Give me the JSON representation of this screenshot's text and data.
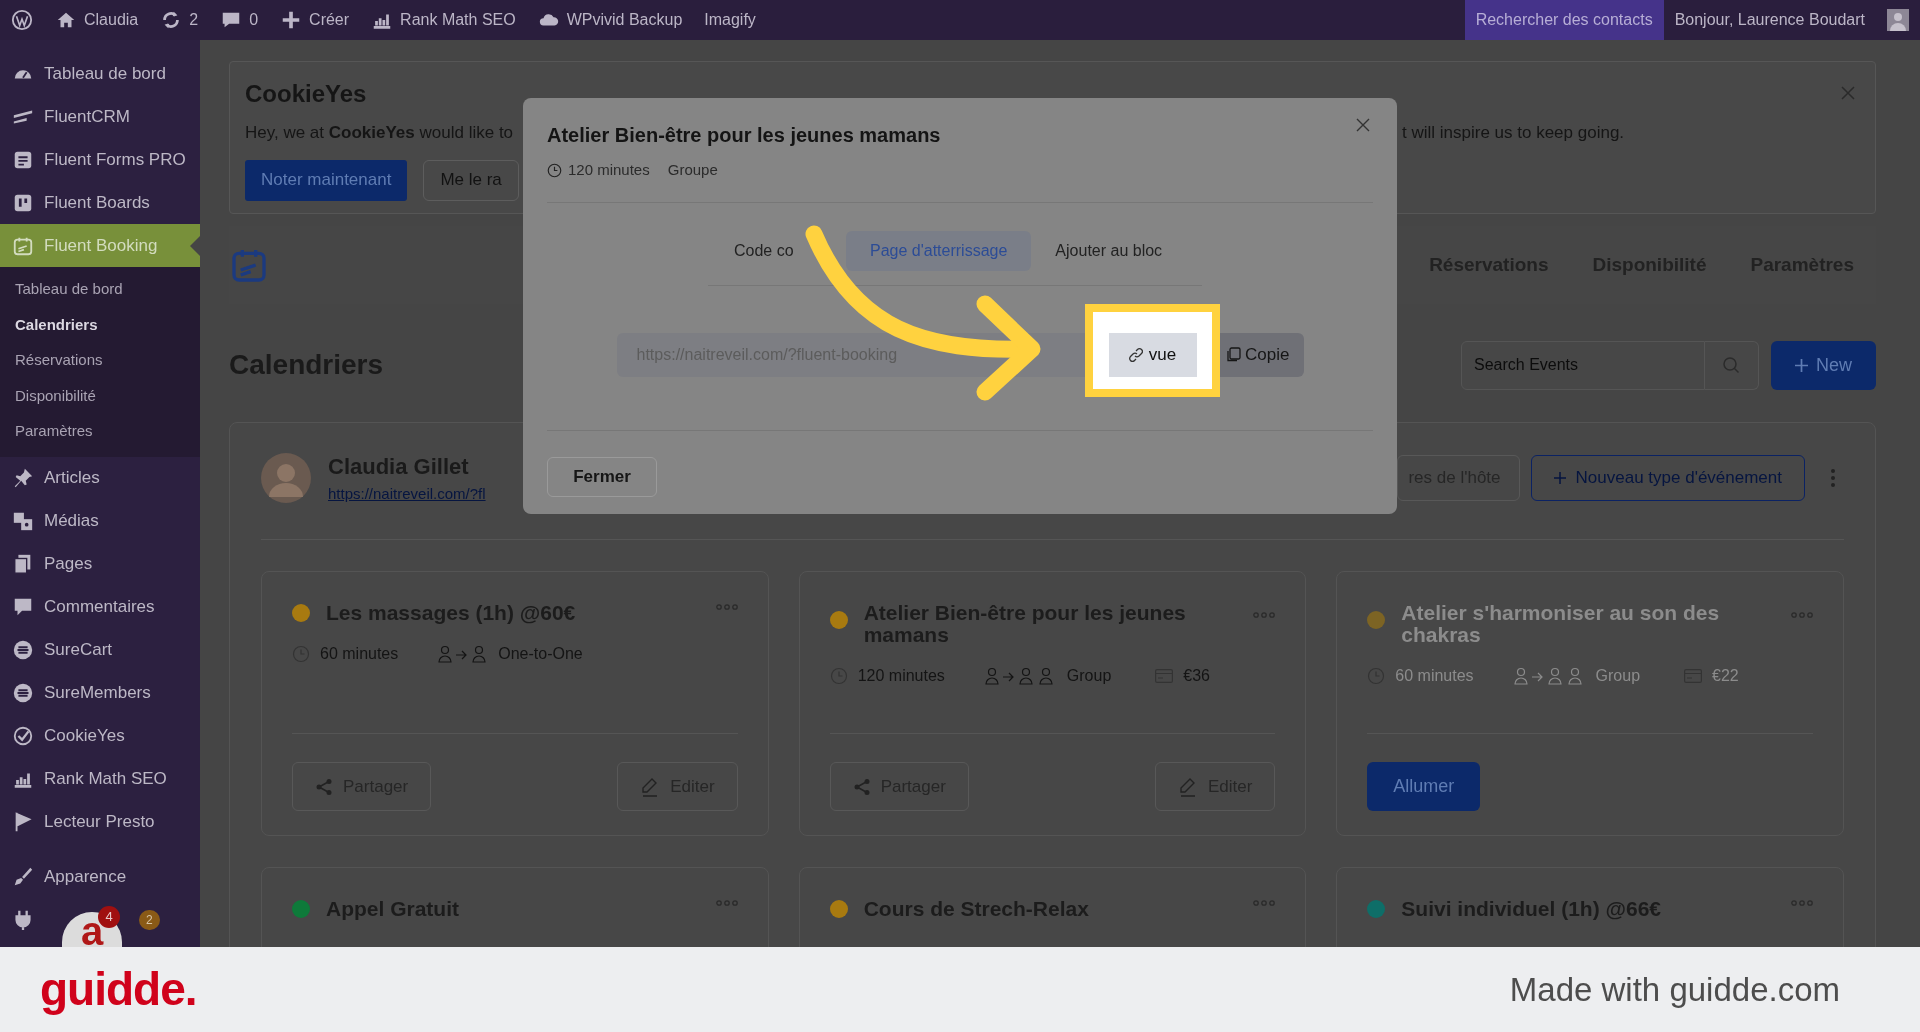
{
  "admin_bar": {
    "items": [
      {
        "kind": "wp"
      },
      {
        "kind": "home",
        "label": "Claudia"
      },
      {
        "kind": "updates",
        "label": "2"
      },
      {
        "kind": "comments",
        "label": "0"
      },
      {
        "kind": "new",
        "label": "Créer"
      },
      {
        "kind": "chart",
        "label": "Rank Math SEO"
      },
      {
        "kind": "cloud",
        "label": "WPvivid Backup"
      },
      {
        "kind": "text",
        "label": "Imagify"
      }
    ],
    "search_contacts": "Rechercher des contacts",
    "greeting": "Bonjour, Laurence Boudart"
  },
  "sidebar": {
    "items": [
      {
        "label": "Tableau de bord",
        "selected": false
      },
      {
        "label": "FluentCRM",
        "selected": false
      },
      {
        "label": "Fluent Forms PRO",
        "selected": false
      },
      {
        "label": "Fluent Boards",
        "selected": false
      },
      {
        "label": "Fluent Booking",
        "selected": true,
        "children": [
          {
            "label": "Tableau de bord",
            "selected": false
          },
          {
            "label": "Calendriers",
            "selected": true
          },
          {
            "label": "Réservations",
            "selected": false
          },
          {
            "label": "Disponibilité",
            "selected": false
          },
          {
            "label": "Paramètres",
            "selected": false
          }
        ]
      },
      {
        "label": "Articles",
        "selected": false
      },
      {
        "label": "Médias",
        "selected": false
      },
      {
        "label": "Pages",
        "selected": false
      },
      {
        "label": "Commentaires",
        "selected": false
      },
      {
        "label": "SureCart",
        "selected": false
      },
      {
        "label": "SureMembers",
        "selected": false
      },
      {
        "label": "CookieYes",
        "selected": false
      },
      {
        "label": "Rank Math SEO",
        "selected": false
      },
      {
        "label": "Lecteur Presto",
        "selected": false
      },
      {
        "label": "Apparence",
        "selected": false
      },
      {
        "count": "2",
        "selected": false
      }
    ]
  },
  "floating_widget": {
    "letter": "a",
    "count": "4"
  },
  "notice": {
    "logo": "CookieYes",
    "text_start": "Hey, we at **CookieYes** would like to",
    "text_end": "t will inspire us to keep going.",
    "buttons": [
      "Noter maintenant",
      "Me le ra"
    ]
  },
  "booking_nav": {
    "tabs": [
      "Réservations",
      "Disponibilité",
      "Paramètres"
    ]
  },
  "heading": "Calendriers",
  "search": {
    "placeholder": "Search Events"
  },
  "new_button": "New",
  "host": {
    "name": "Claudia Gillet",
    "link": "https://naitreveil.com/?fl",
    "settings_button": "res de l'hôte",
    "new_event_button": "Nouveau type d'événement"
  },
  "events": [
    {
      "title": "Les massages (1h) @60€",
      "color": "#a87a10",
      "enabled": true,
      "duration": "60 minutes",
      "type": "One-to-One",
      "group": false,
      "share": "Partager",
      "edit": "Editer"
    },
    {
      "title": "Atelier Bien-être pour les jeunes mamans",
      "color": "#a87a10",
      "enabled": true,
      "duration": "120 minutes",
      "type": "Group",
      "group": true,
      "price": "€36",
      "share": "Partager",
      "edit": "Editer"
    },
    {
      "title": "Atelier s'harmoniser au son des chakras",
      "color": "#7d6424",
      "enabled": false,
      "duration": "60 minutes",
      "type": "Group",
      "group": true,
      "price": "€22",
      "enable_button": "Allumer"
    },
    {
      "title": "Appel Gratuit",
      "color": "#0e7a3a",
      "enabled": true
    },
    {
      "title": "Cours de Strech-Relax",
      "color": "#a87a10",
      "enabled": true
    },
    {
      "title": "Suivi individuel (1h) @66€",
      "color": "#0e6e68",
      "enabled": true
    }
  ],
  "modal": {
    "title": "Atelier Bien-être pour les jeunes mamans",
    "duration": "120 minutes",
    "type": "Groupe",
    "tabs": [
      {
        "label": "Code co",
        "selected": false
      },
      {
        "label": "Page d'atterrissage",
        "selected": true
      },
      {
        "label": "Ajouter au bloc",
        "selected": false
      }
    ],
    "url": "https://naitreveil.com/?fluent-booking",
    "view_button": "vue",
    "copy_button": "Copie",
    "close_button": "Fermer"
  },
  "footer": {
    "brand": "guidde.",
    "credit": "Made with guidde.com"
  }
}
